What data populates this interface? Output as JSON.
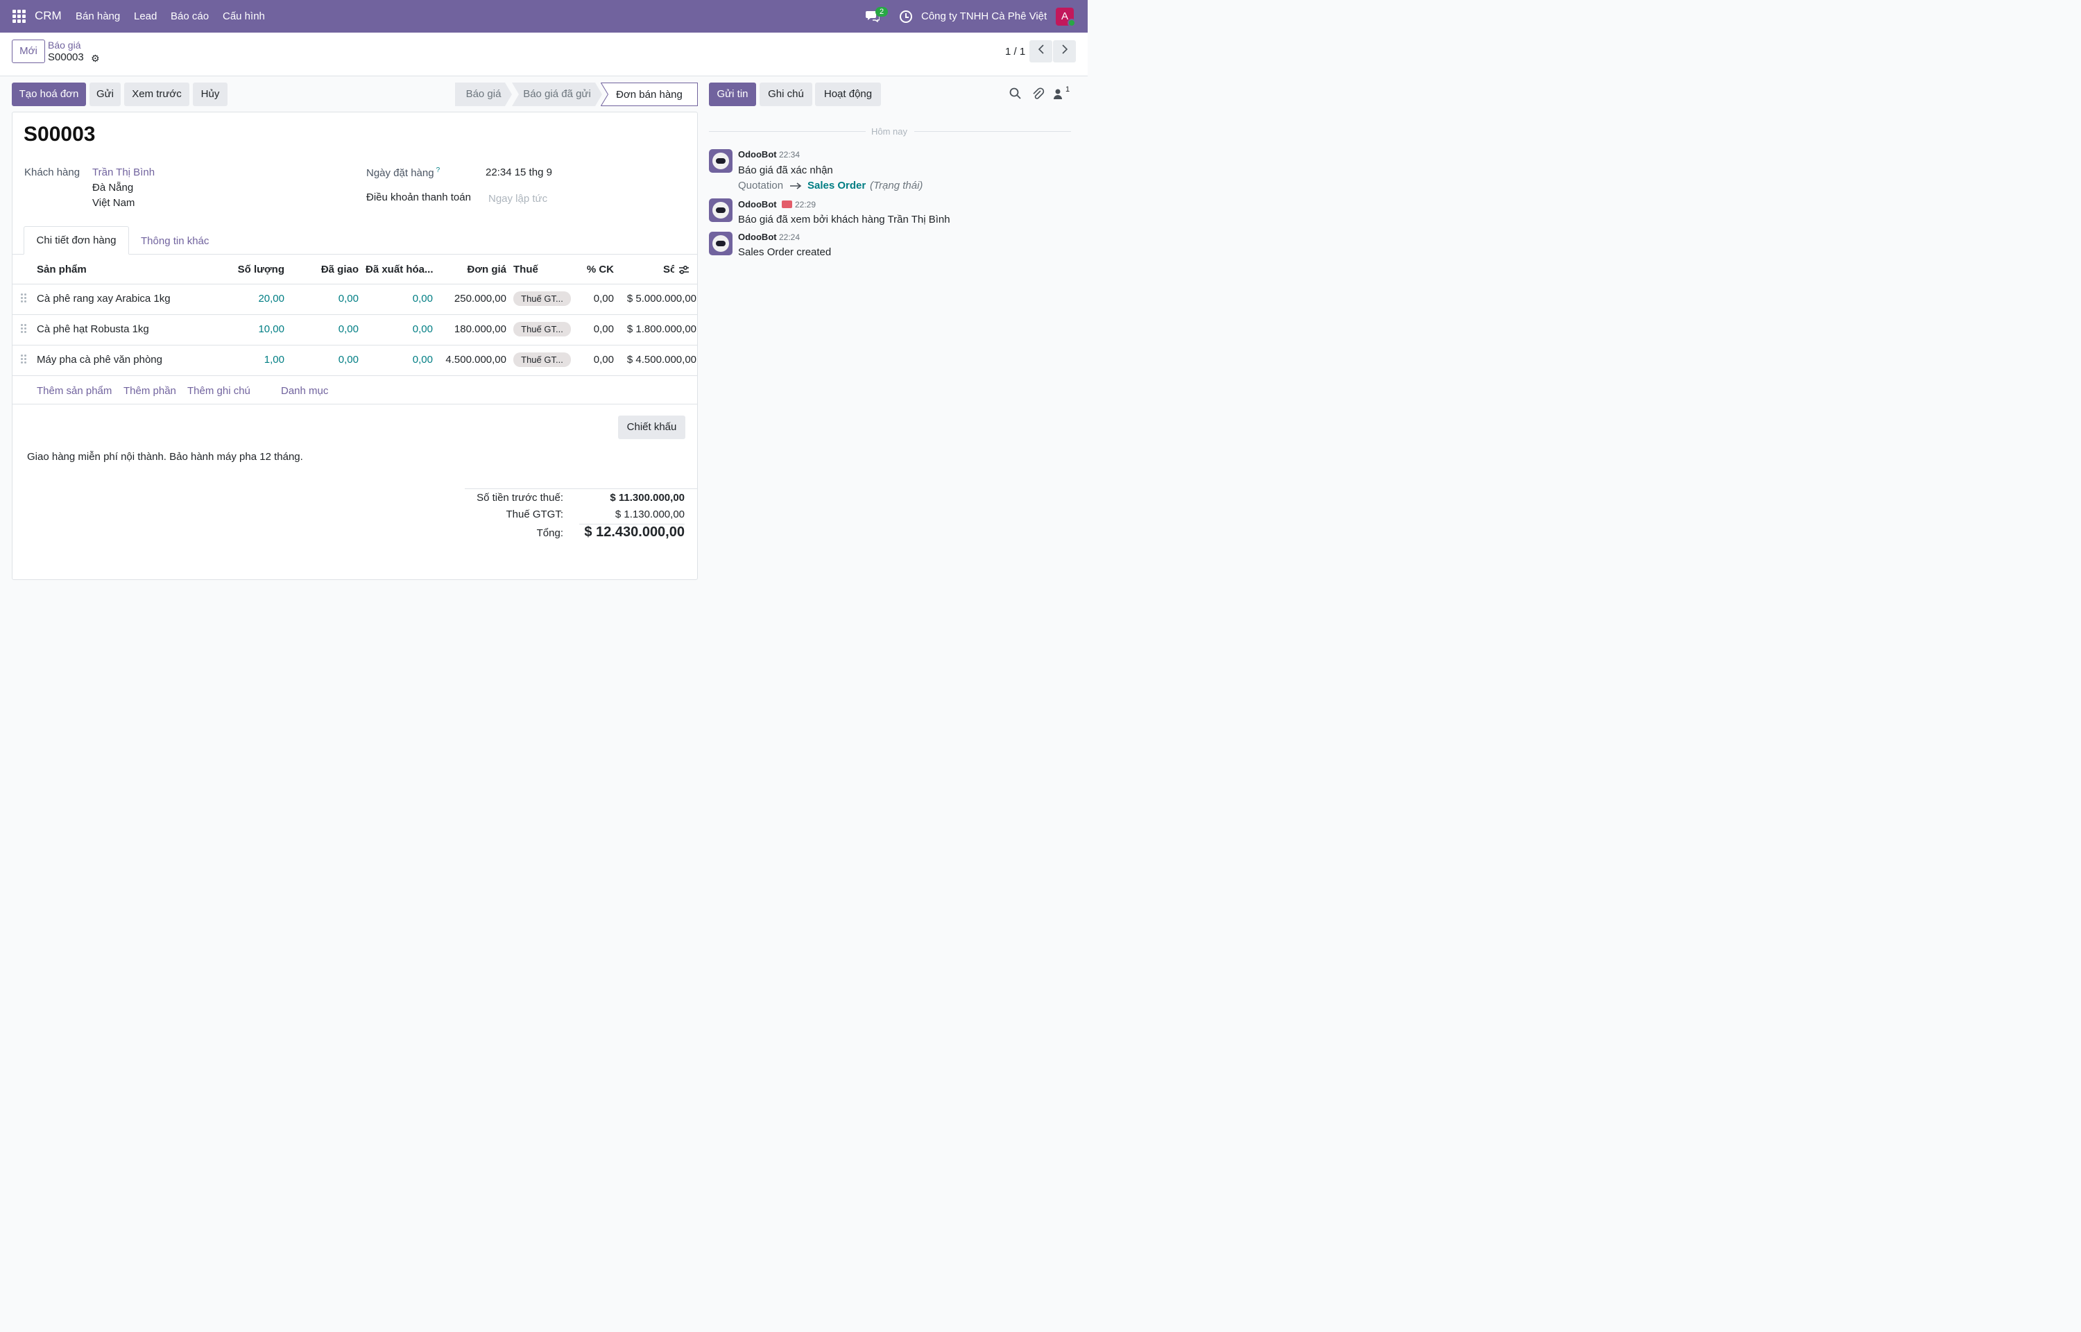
{
  "navbar": {
    "app_name": "CRM",
    "menu": [
      "Bán hàng",
      "Lead",
      "Báo cáo",
      "Cấu hình"
    ],
    "message_count": "2",
    "company": "Công ty TNHH Cà Phê Việt",
    "avatar_letter": "A",
    "brand_color": "#71639e"
  },
  "control_panel": {
    "new_button": "Mới",
    "breadcrumb": "Báo giá",
    "record_name": "S00003",
    "pager": "1 / 1"
  },
  "actions": {
    "create_invoice": "Tạo hoá đơn",
    "send": "Gửi",
    "preview": "Xem trước",
    "cancel": "Hủy"
  },
  "status_bar": {
    "stages": [
      "Báo giá",
      "Báo giá đã gửi",
      "Đơn bán hàng"
    ],
    "active": "Đơn bán hàng"
  },
  "form": {
    "title": "S00003",
    "customer_label": "Khách hàng",
    "customer_name": "Trần Thị Bình",
    "customer_city": "Đà Nẵng",
    "customer_country": "Việt Nam",
    "order_date_label": "Ngày đặt hàng",
    "order_date_help": "?",
    "order_date": "22:34 15 thg 9",
    "payment_terms_label": "Điều khoản thanh toán",
    "payment_terms_placeholder": "Ngay lập tức"
  },
  "tabs": [
    "Chi tiết đơn hàng",
    "Thông tin khác"
  ],
  "order_lines": {
    "columns": [
      "Sản phẩm",
      "Số lượng",
      "Đã giao",
      "Đã xuất hóa...",
      "Đơn giá",
      "Thuế",
      "% CK",
      "Số"
    ],
    "rows": [
      {
        "product": "Cà phê rang xay Arabica 1kg",
        "qty": "20,00",
        "delivered": "0,00",
        "invoiced": "0,00",
        "price": "250.000,00",
        "tax": "Thuế GT...",
        "discount": "0,00",
        "subtotal": "$ 5.000.000,00"
      },
      {
        "product": "Cà phê hạt Robusta 1kg",
        "qty": "10,00",
        "delivered": "0,00",
        "invoiced": "0,00",
        "price": "180.000,00",
        "tax": "Thuế GT...",
        "discount": "0,00",
        "subtotal": "$ 1.800.000,00"
      },
      {
        "product": "Máy pha cà phê văn phòng",
        "qty": "1,00",
        "delivered": "0,00",
        "invoiced": "0,00",
        "price": "4.500.000,00",
        "tax": "Thuế GT...",
        "discount": "0,00",
        "subtotal": "$ 4.500.000,00"
      }
    ],
    "add_links": [
      "Thêm sản phẩm",
      "Thêm phần",
      "Thêm ghi chú",
      "Danh mục"
    ]
  },
  "discount_button": "Chiết khấu",
  "note": "Giao hàng miễn phí nội thành. Bảo hành máy pha 12 tháng.",
  "totals": {
    "untaxed_label": "Số tiền trước thuế:",
    "untaxed_value": "$ 11.300.000,00",
    "tax_label": "Thuế GTGT:",
    "tax_value": "$ 1.130.000,00",
    "total_label": "Tổng:",
    "total_value": "$ 12.430.000,00"
  },
  "chatter": {
    "send_message": "Gửi tin",
    "log_note": "Ghi chú",
    "activities": "Hoạt động",
    "follower_count": "1",
    "date_separator": "Hôm nay",
    "messages": [
      {
        "author": "OdooBot",
        "time": "22:34",
        "body": "Báo giá đã xác nhận",
        "old_value": "Quotation",
        "new_value": "Sales Order",
        "field": "(Trạng thái)"
      },
      {
        "author": "OdooBot",
        "time": "22:29",
        "body": "Báo giá đã xem bởi khách hàng Trần Thị Bình"
      },
      {
        "author": "OdooBot",
        "time": "22:24",
        "body": "Sales Order created"
      }
    ]
  }
}
